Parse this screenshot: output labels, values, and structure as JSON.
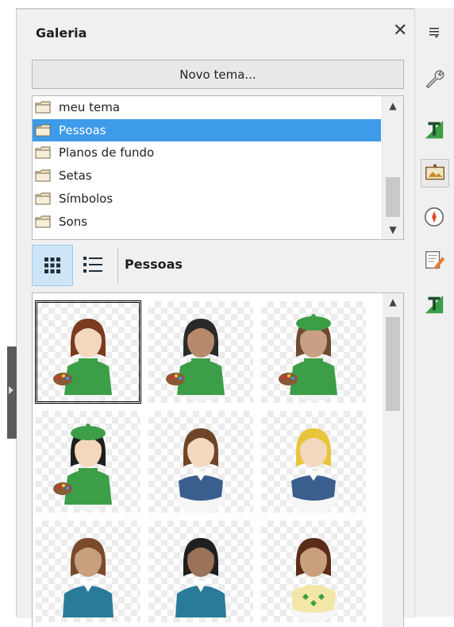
{
  "panel": {
    "title": "Galeria",
    "close_glyph": "✕",
    "new_theme_label": "Novo tema...",
    "themes": [
      {
        "label": "meu tema",
        "selected": false
      },
      {
        "label": "Pessoas",
        "selected": true
      },
      {
        "label": "Planos de fundo",
        "selected": false
      },
      {
        "label": "Setas",
        "selected": false
      },
      {
        "label": "Símbolos",
        "selected": false
      },
      {
        "label": "Sons",
        "selected": false
      }
    ],
    "view_modes": [
      {
        "icon": "icon-view-icon",
        "active": true
      },
      {
        "icon": "detailed-view-icon",
        "active": false
      }
    ],
    "current_theme_label": "Pessoas",
    "scroll_up_glyph": "^",
    "scroll_down_glyph": "v"
  },
  "gallery": {
    "items": [
      {
        "icon": "painter-brown-hair-female-icon",
        "selected": true,
        "hair": "#7a3b1f",
        "skin": "#f3d8bf",
        "shirt": "#3c9e47",
        "hat": null,
        "style": "painter"
      },
      {
        "icon": "painter-dark-hair-female-icon",
        "selected": false,
        "hair": "#2c2a28",
        "skin": "#b78a6c",
        "shirt": "#3c9e47",
        "hat": null,
        "style": "painter"
      },
      {
        "icon": "painter-beret-male-icon",
        "selected": false,
        "hair": "#6c4a30",
        "skin": "#c8a084",
        "shirt": "#3c9e47",
        "hat": "#3c9e47",
        "style": "painter"
      },
      {
        "icon": "painter-beret-black-hair-icon",
        "selected": false,
        "hair": "#1f1f1f",
        "skin": "#f3d8bf",
        "shirt": "#3c9e47",
        "hat": "#3c9e47",
        "style": "painter"
      },
      {
        "icon": "person-brown-hair-vest-icon",
        "selected": false,
        "hair": "#6e4528",
        "skin": "#f3d8bf",
        "shirt": "#3a5f8f",
        "hat": null,
        "style": "vest"
      },
      {
        "icon": "person-blonde-hair-vest-icon",
        "selected": false,
        "hair": "#e6c53a",
        "skin": "#f3d8bf",
        "shirt": "#3a5f8f",
        "hat": null,
        "style": "vest"
      },
      {
        "icon": "person-ponytail-teal-icon",
        "selected": false,
        "hair": "#7a4a2a",
        "skin": "#c9a07e",
        "shirt": "#2a7a9a",
        "hat": null,
        "style": "teal"
      },
      {
        "icon": "person-black-ponytail-teal-icon",
        "selected": false,
        "hair": "#1f1f1f",
        "skin": "#9a7257",
        "shirt": "#2a7a9a",
        "hat": null,
        "style": "teal"
      },
      {
        "icon": "person-argyle-sweater-icon",
        "selected": false,
        "hair": "#5a2d18",
        "skin": "#c9a07e",
        "shirt": "#f3e7a8",
        "hat": null,
        "style": "argyle"
      }
    ]
  },
  "sidebar_deck": {
    "menu_icon": "deck-menu-icon",
    "items": [
      {
        "icon": "properties-wrench-icon",
        "active": false
      },
      {
        "icon": "styles-icon",
        "active": false
      },
      {
        "icon": "gallery-icon",
        "active": true
      },
      {
        "icon": "navigator-icon",
        "active": false
      },
      {
        "icon": "manage-changes-icon",
        "active": false
      },
      {
        "icon": "page-styles-icon",
        "active": false
      }
    ]
  },
  "colors": {
    "selection": "#3d9be9",
    "folder_fill": "#efe3c8",
    "folder_stroke": "#7a6a4a",
    "accent_green": "#2d8c3c"
  }
}
